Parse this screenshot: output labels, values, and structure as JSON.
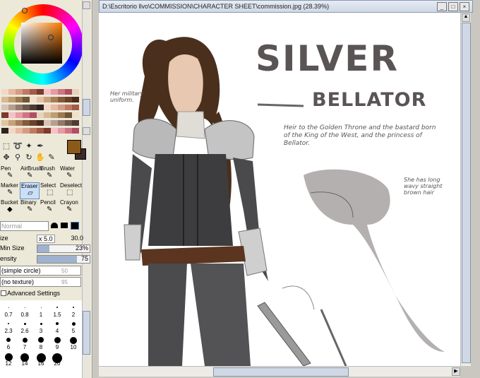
{
  "window": {
    "title": "D:\\Escritorio llvo\\COMMISSION\\CHARACTER SHEET\\commission.jpg (28.39%)",
    "minimize_label": "_",
    "restore_label": "□",
    "close_label": "×"
  },
  "brushes": [
    {
      "label": "Pen",
      "icon": "pen-icon",
      "glyph": "✎"
    },
    {
      "label": "AirBrush",
      "icon": "airbrush-icon",
      "glyph": "✎"
    },
    {
      "label": "Brush",
      "icon": "brush-icon",
      "glyph": "✎"
    },
    {
      "label": "Water",
      "icon": "water-icon",
      "glyph": "✎"
    },
    {
      "label": "Marker",
      "icon": "marker-icon",
      "glyph": "✎"
    },
    {
      "label": "Eraser",
      "icon": "eraser-icon",
      "glyph": "▱"
    },
    {
      "label": "Select",
      "icon": "select-icon",
      "glyph": "⬚"
    },
    {
      "label": "Deselect",
      "icon": "deselect-icon",
      "glyph": "⬚"
    },
    {
      "label": "Bucket",
      "icon": "bucket-icon",
      "glyph": "◆"
    },
    {
      "label": "Binary",
      "icon": "binary-icon",
      "glyph": "✎"
    },
    {
      "label": "Pencil",
      "icon": "pencil-icon",
      "glyph": "✎"
    },
    {
      "label": "Crayon",
      "icon": "crayon-icon",
      "glyph": "✎"
    }
  ],
  "selected_brush": "Eraser",
  "blend_mode": "Normal",
  "size": {
    "label": "ize",
    "multiplier": "x 5.0",
    "value": "30.0"
  },
  "min_size": {
    "label": "Min Size",
    "value": "23%",
    "fraction": 0.23
  },
  "density": {
    "label": "ensity",
    "value": "75",
    "fraction": 0.75
  },
  "shape_dropdown": {
    "value": "(simple circle)",
    "strength": "50"
  },
  "texture_dropdown": {
    "value": "(no texture)",
    "strength": "95"
  },
  "advanced_settings": "Advanced Settings",
  "brush_sizes": [
    "0.7",
    "0.8",
    "1",
    "1.5",
    "2",
    "2.3",
    "2.6",
    "3",
    "4",
    "5",
    "6",
    "7",
    "8",
    "9",
    "10",
    "12",
    "14",
    "16",
    "20"
  ],
  "art": {
    "title_line1": "SILVER",
    "title_line2": "BELLATOR",
    "note_uniform": "Her military uniform.",
    "note_heir": "Heir to the Golden Throne and the bastard born of the King of the West, and the princess of Bellator.",
    "note_hair": "She has long wavy straight brown hair"
  },
  "colors": {
    "foreground": "#8b5a1a",
    "background": "#3b2a28",
    "selected_hue": "#ff7a00"
  }
}
